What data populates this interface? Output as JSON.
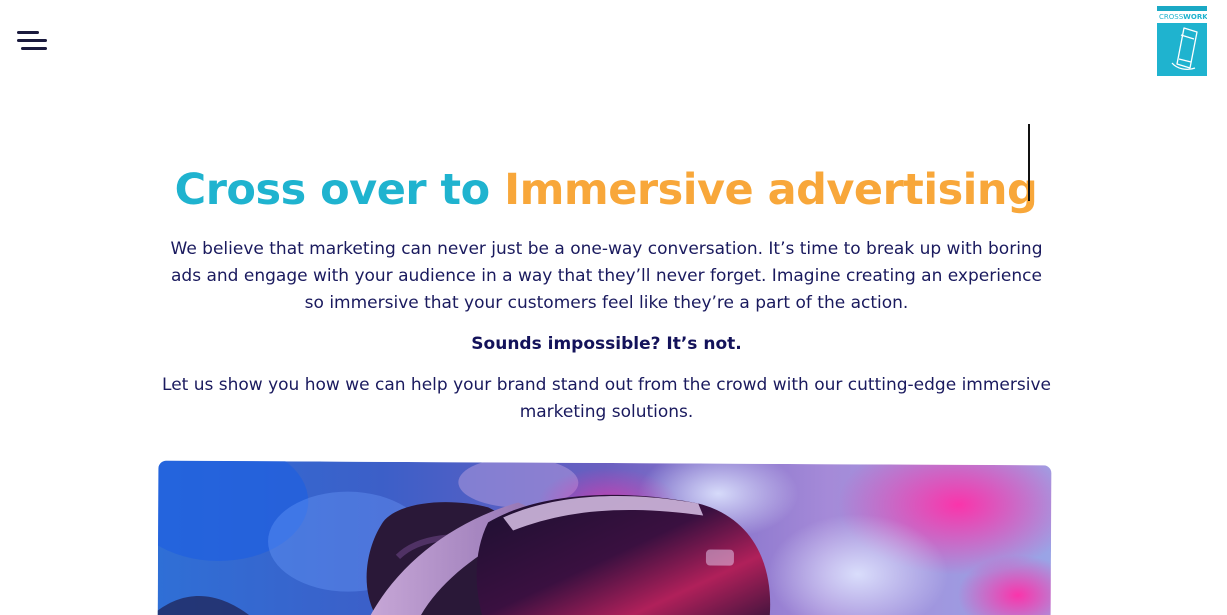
{
  "header": {
    "menu_icon": "hamburger-menu-icon",
    "logo": {
      "text_part1": "CROSS",
      "text_part2": "WORKS",
      "colors": {
        "brand": "#1fb3cf"
      }
    }
  },
  "hero": {
    "headline_part1": "Cross over to ",
    "headline_part2": "Immersive advertising",
    "intro": "We believe that marketing can never just be a one-way conversation. It’s time to break up with boring ads and engage with your audience in a way that they’ll never forget. Imagine creating an experience so immersive that your customers feel like they’re a part of the action.",
    "tagline": "Sounds impossible? It’s not.",
    "cta_text": "Let us show you how we can help your brand stand out from the crowd with our cutting-edge immersive marketing solutions."
  },
  "image": {
    "subject": "vr-headset-photo"
  },
  "colors": {
    "accent_teal": "#1fb3cf",
    "accent_orange": "#f8a73a",
    "text_navy": "#1a1a5e"
  }
}
